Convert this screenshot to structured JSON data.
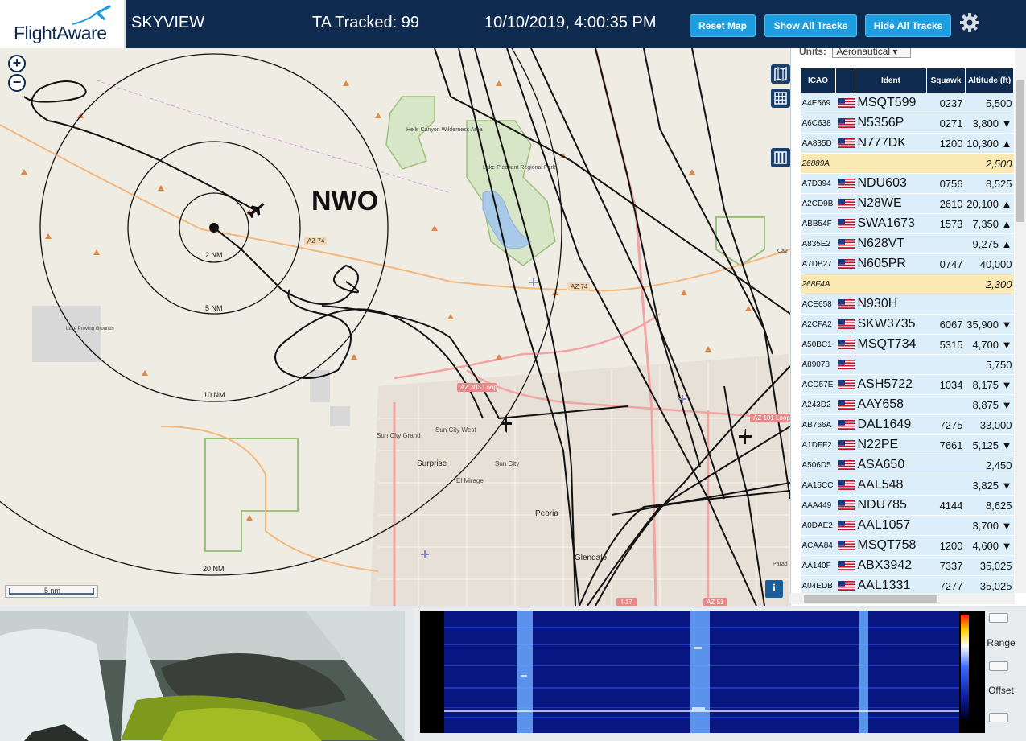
{
  "header": {
    "logo_text": "FlightAware",
    "app_title": "SKYVIEW",
    "tracked_text": "TA Tracked: 99",
    "datetime": "10/10/2019, 4:00:35 PM",
    "buttons": {
      "reset_map": "Reset Map",
      "show_all": "Show All Tracks",
      "hide_all": "Hide All Tracks"
    },
    "settings_icon": "gear-icon"
  },
  "map": {
    "zoom_in": "+",
    "zoom_out": "−",
    "station_label": "NWO",
    "range_rings": [
      "2 NM",
      "5 NM",
      "10 NM",
      "20 NM"
    ],
    "scale": "5 nm",
    "info": "i",
    "roads": [
      "AZ 74",
      "AZ 74",
      "AZ 303 Loop",
      "AZ 101 Loop",
      "AZ 51",
      "I-17"
    ],
    "places": [
      "Hells Canyon Wilderness Area",
      "Lake Pleasant Regional Park",
      "Sun City Grand",
      "Sun City West",
      "Surprise",
      "Sun City",
      "El Mirage",
      "Peoria",
      "Glendale",
      "Luke Proving Grounds",
      "Cav",
      "Parad"
    ],
    "tools": [
      "map-icon",
      "grid-icon",
      "columns-icon"
    ]
  },
  "panel": {
    "units_label": "Units:",
    "units_value": "Aeronautical",
    "columns": [
      "ICAO",
      "",
      "Ident",
      "Squawk",
      "Altitude (ft)"
    ],
    "rows": [
      {
        "icao": "A4E569",
        "ident": "MSQT599",
        "squawk": "0237",
        "alt": "5,500",
        "yellow": false
      },
      {
        "icao": "A6C638",
        "ident": "N5356P",
        "squawk": "0271",
        "alt": "3,800 ▼",
        "yellow": false
      },
      {
        "icao": "AA835D",
        "ident": "N777DK",
        "squawk": "1200",
        "alt": "10,300 ▲",
        "yellow": false
      },
      {
        "icao": "26889A",
        "ident": "",
        "squawk": "",
        "alt": "2,500",
        "yellow": true
      },
      {
        "icao": "A7D394",
        "ident": "NDU603",
        "squawk": "0756",
        "alt": "8,525",
        "yellow": false
      },
      {
        "icao": "A2CD9B",
        "ident": "N28WE",
        "squawk": "2610",
        "alt": "20,100 ▲",
        "yellow": false
      },
      {
        "icao": "ABB54F",
        "ident": "SWA1673",
        "squawk": "1573",
        "alt": "7,350 ▲",
        "yellow": false
      },
      {
        "icao": "A835E2",
        "ident": "N628VT",
        "squawk": "",
        "alt": "9,275 ▲",
        "yellow": false
      },
      {
        "icao": "A7DB27",
        "ident": "N605PR",
        "squawk": "0747",
        "alt": "40,000",
        "yellow": false
      },
      {
        "icao": "268F4A",
        "ident": "",
        "squawk": "",
        "alt": "2,300",
        "yellow": true
      },
      {
        "icao": "ACE658",
        "ident": "N930H",
        "squawk": "",
        "alt": "",
        "yellow": false
      },
      {
        "icao": "A2CFA2",
        "ident": "SKW3735",
        "squawk": "6067",
        "alt": "35,900 ▼",
        "yellow": false
      },
      {
        "icao": "A50BC1",
        "ident": "MSQT734",
        "squawk": "5315",
        "alt": "4,700 ▼",
        "yellow": false
      },
      {
        "icao": "A89078",
        "ident": "",
        "squawk": "",
        "alt": "5,750",
        "yellow": false
      },
      {
        "icao": "ACD57E",
        "ident": "ASH5722",
        "squawk": "1034",
        "alt": "8,175 ▼",
        "yellow": false
      },
      {
        "icao": "A243D2",
        "ident": "AAY658",
        "squawk": "",
        "alt": "8,875 ▼",
        "yellow": false
      },
      {
        "icao": "AB766A",
        "ident": "DAL1649",
        "squawk": "7275",
        "alt": "33,000",
        "yellow": false
      },
      {
        "icao": "A1DFF2",
        "ident": "N22PE",
        "squawk": "7661",
        "alt": "5,125 ▼",
        "yellow": false
      },
      {
        "icao": "A506D5",
        "ident": "ASA650",
        "squawk": "",
        "alt": "2,450",
        "yellow": false
      },
      {
        "icao": "AA15CC",
        "ident": "AAL548",
        "squawk": "",
        "alt": "3,825 ▼",
        "yellow": false
      },
      {
        "icao": "AAA449",
        "ident": "NDU785",
        "squawk": "4144",
        "alt": "8,625",
        "yellow": false
      },
      {
        "icao": "A0DAE2",
        "ident": "AAL1057",
        "squawk": "",
        "alt": "3,700 ▼",
        "yellow": false
      },
      {
        "icao": "ACAA84",
        "ident": "MSQT758",
        "squawk": "1200",
        "alt": "4,600 ▼",
        "yellow": false
      },
      {
        "icao": "AA140F",
        "ident": "ABX3942",
        "squawk": "7337",
        "alt": "35,025",
        "yellow": false
      },
      {
        "icao": "A04EDB",
        "ident": "AAL1331",
        "squawk": "7277",
        "alt": "35,025",
        "yellow": false
      }
    ]
  },
  "spectrum": {
    "range_label": "Range",
    "offset_label": "Offset"
  },
  "colors": {
    "header_bg": "#0e2a4f",
    "button_bg": "#1c9ee0",
    "row_blue": "#dbeef9",
    "row_yellow": "#fbe9b4"
  }
}
